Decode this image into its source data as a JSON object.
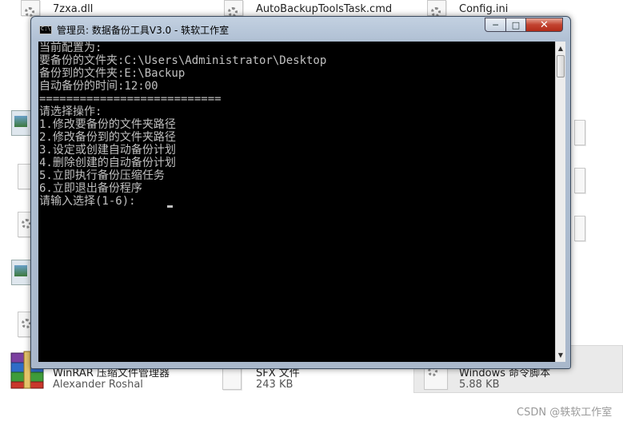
{
  "background_files": {
    "top": [
      {
        "name": "7zxa.dll"
      },
      {
        "name": "AutoBackupToolsTask.cmd"
      },
      {
        "name": "Config.ini"
      }
    ],
    "bottom": [
      {
        "name": "WinRAR 压缩文件管理器",
        "sub": "Alexander Roshal"
      },
      {
        "name": "SFX 文件",
        "sub": "243 KB"
      },
      {
        "name": "Windows 命令脚本",
        "sub": "5.88 KB"
      }
    ]
  },
  "window": {
    "title": "管理员:  数据备份工具V3.0 - 轶软工作室",
    "icon_text": "C:\\",
    "minimize_label": "─",
    "maximize_label": "□",
    "close_label": "✕"
  },
  "console": {
    "lines": [
      "当前配置为:",
      "要备份的文件夹:C:\\Users\\Administrator\\Desktop",
      "备份到的文件夹:E:\\Backup",
      "自动备份的时间:12:00",
      "===========================",
      "请选择操作:",
      "1.修改要备份的文件夹路径",
      "2.修改备份到的文件夹路径",
      "3.设定或创建自动备份计划",
      "4.删除创建的自动备份计划",
      "5.立即执行备份压缩任务",
      "6.立即退出备份程序",
      "请输入选择(1-6): "
    ]
  },
  "scrollbar": {
    "up": "▲",
    "down": "▼"
  },
  "watermark": "CSDN @轶软工作室"
}
